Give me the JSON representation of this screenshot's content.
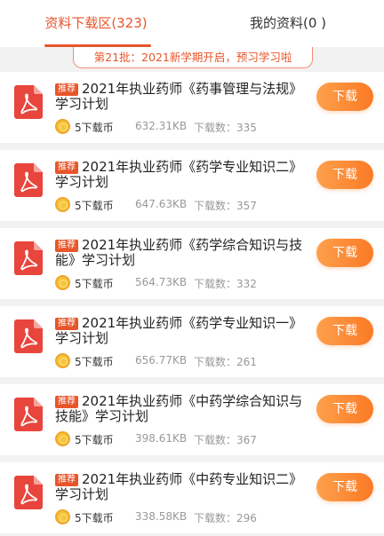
{
  "tabs": [
    {
      "label": "资料下载区(323)",
      "active": true
    },
    {
      "label": "我的资料(0 )",
      "active": false
    }
  ],
  "banner": {
    "text": "第21批：2021新学期开启，预习学习啦"
  },
  "colors": {
    "accent": "#e8552a",
    "button": "#fb7a25",
    "coin": "#f7c43a",
    "pdf": "#e8453c"
  },
  "items": [
    {
      "tag": "推荐",
      "title": "2021年执业药师《药事管理与法规》学习计划",
      "cost": "5下载币",
      "size": "632.31KB",
      "downloads": "下载数：335",
      "button": "下载",
      "icon": "pdf-icon"
    },
    {
      "tag": "推荐",
      "title": "2021年执业药师《药学专业知识二》学习计划",
      "cost": "5下载币",
      "size": "647.63KB",
      "downloads": "下载数：357",
      "button": "下载",
      "icon": "pdf-icon"
    },
    {
      "tag": "推荐",
      "title": "2021年执业药师《药学综合知识与技能》学习计划",
      "cost": "5下载币",
      "size": "564.73KB",
      "downloads": "下载数：332",
      "button": "下载",
      "icon": "pdf-icon"
    },
    {
      "tag": "推荐",
      "title": "2021年执业药师《药学专业知识一》学习计划",
      "cost": "5下载币",
      "size": "656.77KB",
      "downloads": "下载数：261",
      "button": "下载",
      "icon": "pdf-icon"
    },
    {
      "tag": "推荐",
      "title": "2021年执业药师《中药学综合知识与技能》学习计划",
      "cost": "5下载币",
      "size": "398.61KB",
      "downloads": "下载数：367",
      "button": "下载",
      "icon": "pdf-icon"
    },
    {
      "tag": "推荐",
      "title": "2021年执业药师《中药专业知识二》学习计划",
      "cost": "5下载币",
      "size": "338.58KB",
      "downloads": "下载数：296",
      "button": "下载",
      "icon": "pdf-icon"
    }
  ]
}
